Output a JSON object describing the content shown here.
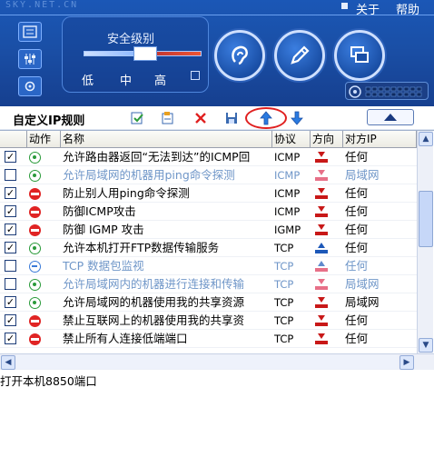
{
  "header": {
    "watermark": "SKY.NET.CN",
    "about_label": "关于",
    "help_label": "帮助",
    "security_level_title": "安全级别",
    "levels": [
      "低",
      "中",
      "高"
    ]
  },
  "toolbar": {
    "title": "自定义IP规则"
  },
  "table": {
    "columns": [
      "动作",
      "名称",
      "协议",
      "方向",
      "对方IP"
    ],
    "rows": [
      {
        "checked": true,
        "action": "allow",
        "name": "允许路由器返回“无法到达”的ICMP回",
        "protocol": "ICMP",
        "direction": "in",
        "remote": "任何",
        "disabled": false
      },
      {
        "checked": false,
        "action": "allow",
        "name": "允许局域网的机器用ping命令探测",
        "protocol": "ICMP",
        "direction": "in",
        "remote": "局域网",
        "disabled": true
      },
      {
        "checked": true,
        "action": "deny",
        "name": "防止别人用ping命令探测",
        "protocol": "ICMP",
        "direction": "in",
        "remote": "任何",
        "disabled": false
      },
      {
        "checked": true,
        "action": "deny",
        "name": "防御ICMP攻击",
        "protocol": "ICMP",
        "direction": "in",
        "remote": "任何",
        "disabled": false
      },
      {
        "checked": true,
        "action": "deny",
        "name": "防御 IGMP 攻击",
        "protocol": "IGMP",
        "direction": "in",
        "remote": "任何",
        "disabled": false
      },
      {
        "checked": true,
        "action": "allow",
        "name": "允许本机打开FTP数据传输服务",
        "protocol": "TCP",
        "direction": "up",
        "remote": "任何",
        "disabled": false
      },
      {
        "checked": false,
        "action": "monitor",
        "name": "TCP   数据包监视",
        "protocol": "TCP",
        "direction": "up",
        "remote": "任何",
        "disabled": true
      },
      {
        "checked": false,
        "action": "allow",
        "name": "允许局域网内的机器进行连接和传输",
        "protocol": "TCP",
        "direction": "in",
        "remote": "局域网",
        "disabled": true
      },
      {
        "checked": true,
        "action": "allow",
        "name": "允许局域网的机器使用我的共享资源",
        "protocol": "TCP",
        "direction": "in",
        "remote": "局域网",
        "disabled": false
      },
      {
        "checked": true,
        "action": "deny",
        "name": "禁止互联网上的机器使用我的共享资",
        "protocol": "TCP",
        "direction": "in",
        "remote": "任何",
        "disabled": false
      },
      {
        "checked": true,
        "action": "deny",
        "name": "禁止所有人连接低端端口",
        "protocol": "TCP",
        "direction": "in",
        "remote": "任何",
        "disabled": false
      }
    ]
  },
  "description": "打开本机8850端口",
  "colors": {
    "header_blue": "#1b57b6",
    "allow_green": "#2a9a3a",
    "deny_red": "#e02424",
    "disabled_text": "#6f96c8",
    "highlight_red": "#e02020"
  }
}
